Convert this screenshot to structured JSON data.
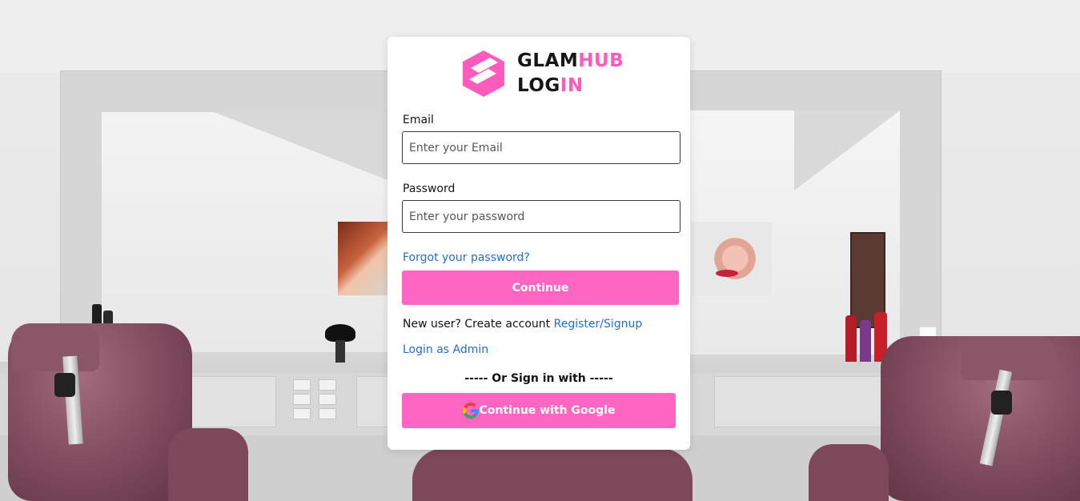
{
  "brand": {
    "line1_a": "GLAM",
    "line1_b": "HUB",
    "line2_a": "LOG",
    "line2_b": "IN",
    "accent_color": "#ff5bbd",
    "logo_icon": "glamhub-hexagon-logo"
  },
  "form": {
    "email_label": "Email",
    "email_placeholder": "Enter your Email",
    "email_value": "",
    "password_label": "Password",
    "password_placeholder": "Enter your password",
    "password_value": "",
    "forgot_link": "Forgot your password?",
    "continue_label": "Continue",
    "new_user_text": "New user? Create account",
    "register_link": "Register/Signup",
    "admin_link": "Login as Admin",
    "divider_text": "----- Or Sign in with -----",
    "google_label": "Continue with Google",
    "google_icon": "google-icon"
  },
  "colors": {
    "button": "#ff66c4",
    "link": "#1e6fd6"
  }
}
